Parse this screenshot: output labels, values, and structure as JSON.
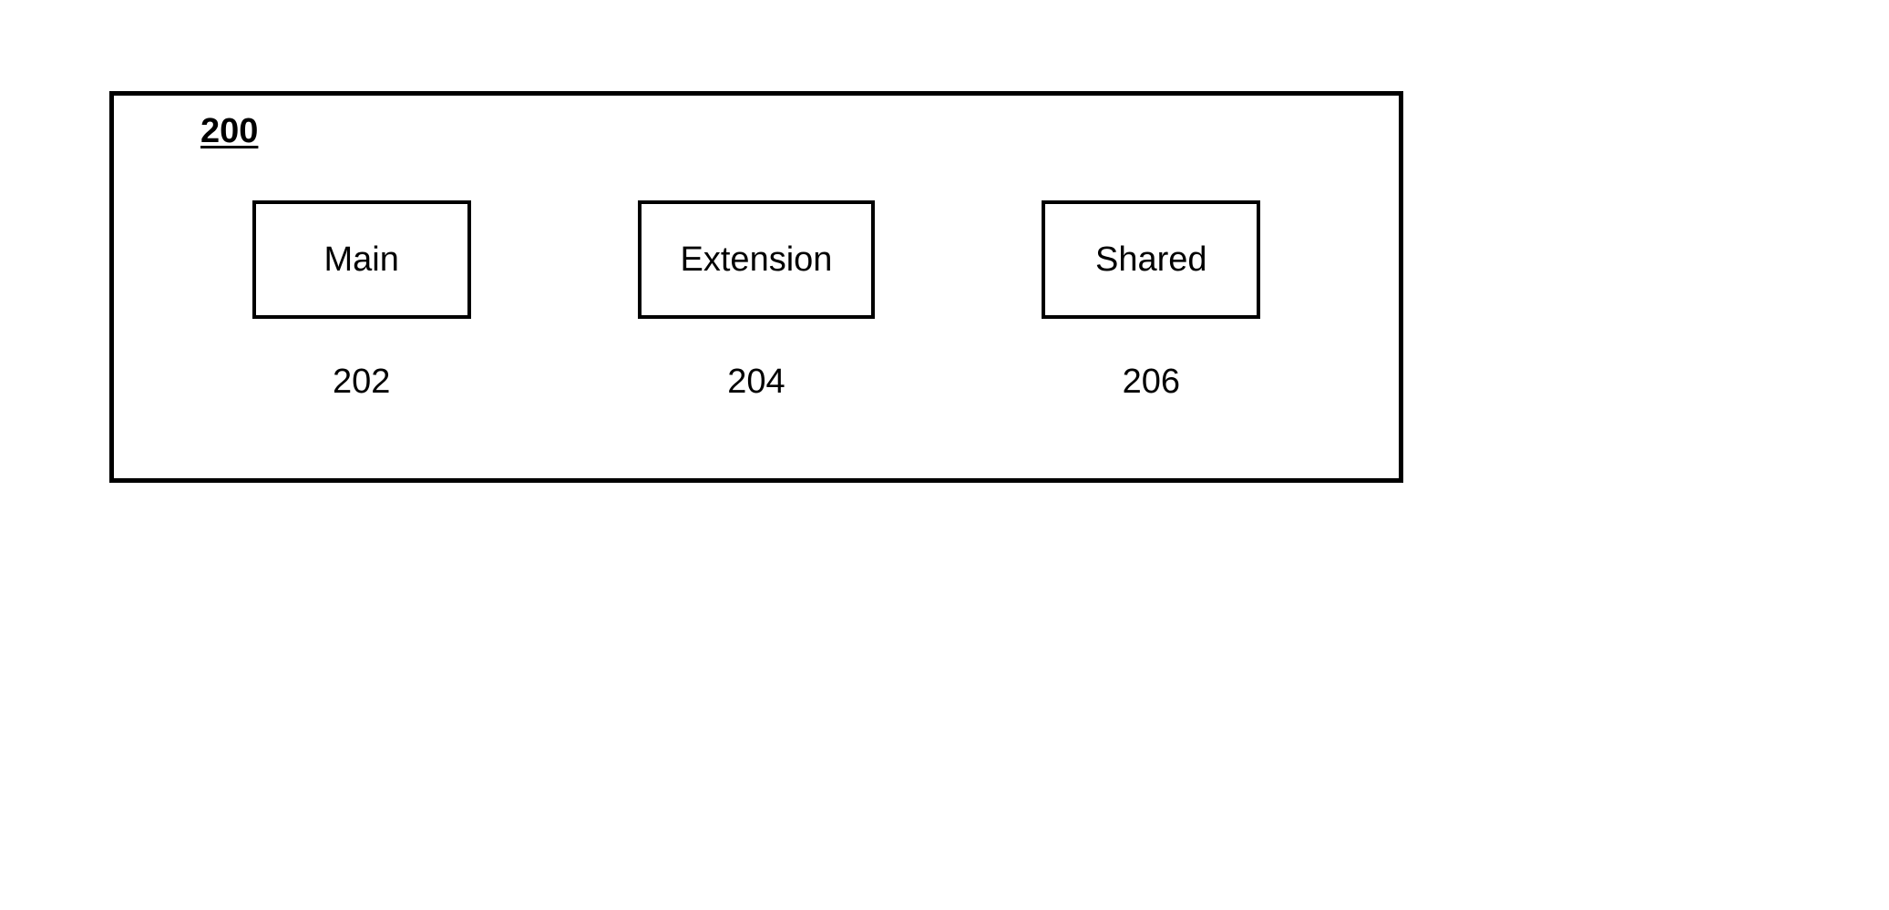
{
  "figure": {
    "id": "200",
    "blocks": [
      {
        "label": "Main",
        "ref": "202"
      },
      {
        "label": "Extension",
        "ref": "204"
      },
      {
        "label": "Shared",
        "ref": "206"
      }
    ]
  }
}
